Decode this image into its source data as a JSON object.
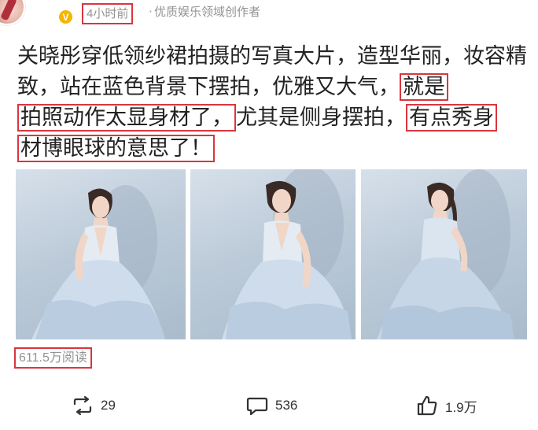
{
  "header": {
    "verified_badge": "V",
    "time": "4小时前",
    "separator": "·",
    "author_title": "优质娱乐领域创作者"
  },
  "post": {
    "text_plain": "关晓彤穿低领纱裙拍摄的写真大片，造型华丽，妆容精致，站在蓝色背景下摆拍，优雅又大气，",
    "text_hl_1": "就是",
    "text_hl_2": "拍照动作太显身材了，",
    "text_mid": "尤其是侧身摆拍，",
    "text_hl_3": "有点秀身",
    "text_hl_4": "材博眼球的意思了！"
  },
  "photos": [
    {
      "icon": "photo-woman-ruffled-gown"
    },
    {
      "icon": "photo-woman-seated-gown"
    },
    {
      "icon": "photo-woman-standing-gown"
    }
  ],
  "stats": {
    "reads": "611.5万阅读"
  },
  "actions": {
    "repost_count": "29",
    "comment_count": "536",
    "like_count": "1.9万"
  },
  "colors": {
    "highlight_border": "#d9363e",
    "meta_text": "#939393",
    "badge": "#f7b500"
  }
}
